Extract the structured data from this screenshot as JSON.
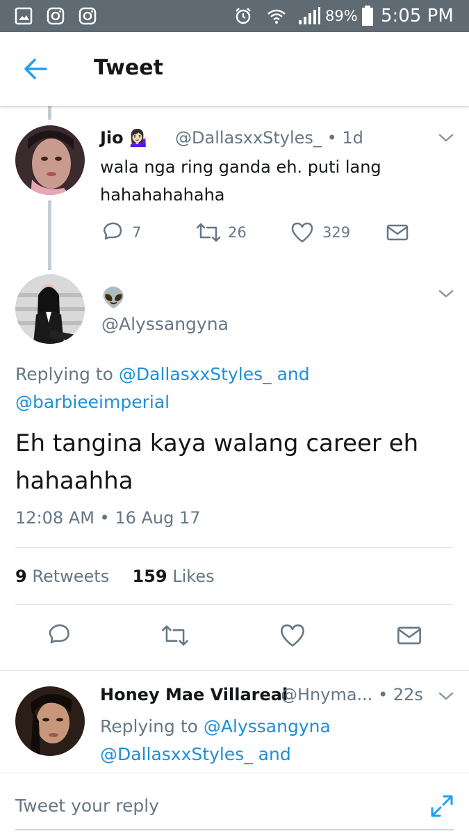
{
  "status_bar": {
    "battery": "89%",
    "time": "5:05 PM",
    "icons": [
      "gallery-icon",
      "instagram-icon",
      "instagram-icon",
      "alarm-icon",
      "wifi-icon",
      "signal-icon",
      "battery-icon"
    ]
  },
  "header": {
    "title": "Tweet"
  },
  "parent_tweet": {
    "name": "Jio",
    "name_emoji": "💁🏻‍♀️",
    "handle": "@DallasxxStyles_",
    "time_sep": "•",
    "time": "1d",
    "text": "wala nga ring ganda eh. puti lang hahahahahaha",
    "actions": {
      "replies": "7",
      "retweets": "26",
      "likes": "329"
    }
  },
  "main_tweet": {
    "name_emoji": "👽",
    "handle": "@Alyssangyna",
    "replying_prefix": "Replying to",
    "replying_user1": "@DallasxxStyles_",
    "replying_and": "and",
    "replying_user2": "@barbieeimperial",
    "text": "Eh tangina kaya walang career eh hahaahha",
    "timestamp": "12:08 AM • 16 Aug 17",
    "stats": {
      "retweets_count": "9",
      "retweets_label": "Retweets",
      "likes_count": "159",
      "likes_label": "Likes"
    }
  },
  "reply_tweet": {
    "name": "Honey Mae Villareal",
    "handle": "@Hnyma...",
    "time_sep": "•",
    "time": "22s",
    "replying_prefix": "Replying to",
    "replying_user1": "@Alyssangyna",
    "replying_user2": "@DallasxxStyles_",
    "replying_and": "and"
  },
  "reply_bar": {
    "placeholder": "Tweet your reply"
  },
  "colors": {
    "accent": "#1da1f2",
    "link": "#1d8fd7",
    "muted": "#657786",
    "status_bar": "#5f6a73"
  }
}
